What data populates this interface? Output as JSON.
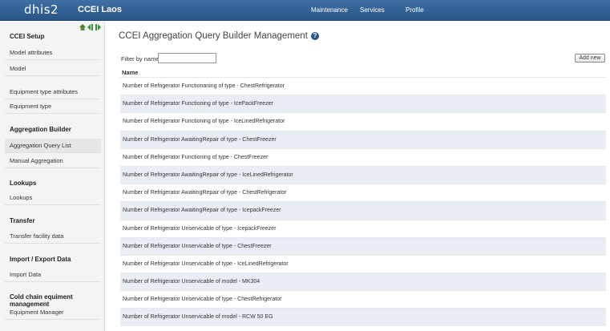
{
  "header": {
    "logo": "dhis2",
    "app_title": "CCEI Laos",
    "menu": [
      "Maintenance",
      "Services",
      "Profile"
    ]
  },
  "sidebar": {
    "sections": [
      {
        "heading": "CCEI Setup",
        "items": [
          "Model attributes",
          "Model",
          "Equipment type attributes",
          "Equipment type"
        ]
      },
      {
        "heading": "Aggregation Builder",
        "items": [
          "Aggregation Query List",
          "Manual Aggregation"
        ]
      },
      {
        "heading": "Lookups",
        "items": [
          "Lookups"
        ]
      },
      {
        "heading": "Transfer",
        "items": [
          "Transfer facility data"
        ]
      },
      {
        "heading": "Import / Export Data",
        "items": [
          "Import Data"
        ]
      },
      {
        "heading": "Cold chain equiment management",
        "items": [
          "Equipment Manager"
        ]
      }
    ],
    "active_item": "Aggregation Query List"
  },
  "main": {
    "title": "CCEI Aggregation Query Builder Management",
    "filter_label": "Filter by name",
    "filter_value": "",
    "add_button": "Add new",
    "column_header": "Name",
    "rows": [
      "Number of Refrigerator Functionaning of type - ChestRefrigerator",
      "Number of Refrigerator Functioning of type - IcePackFreezer",
      "Number of Refrigerator Functioning of type - IceLinedRefrigerator",
      "Number of Refrigerator AwaitingRepair of type - ChestFreezer",
      "Number of Refrigerator Functioning of type - ChestFreezer",
      "Number of Refrigerator AwaitingRepair of type - IceLinedRefrigerator",
      "Number of Refrigerator AwaitingRepair of type - ChestRefrigerator",
      "Number of Refrigerator AwaitingRepair of type - IcepackFreezer",
      "Number of Refrigerator Unservicable of type - IcepackFreezer",
      "Number of Refrigerator Unservicable of type - ChestFreezer",
      "Number of Refrigerator Unservicable of type - IceLinedRefrigerator",
      "Number of Refrigerator Unservicable of model - MK304",
      "Number of Refrigerator Unservicable of type - ChestRefrigerator",
      "Number of Refrigerator Unservicable of model - RCW 50 EG"
    ]
  }
}
